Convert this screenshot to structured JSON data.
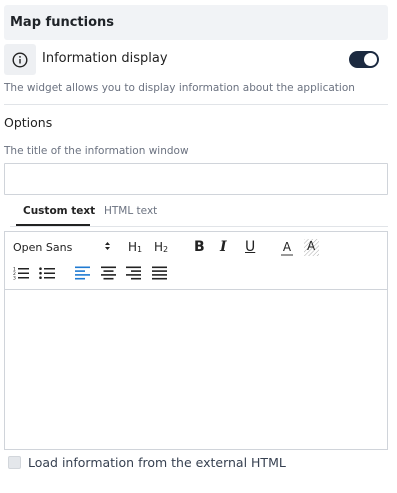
{
  "section": {
    "title": "Map functions"
  },
  "feature": {
    "label": "Information display",
    "enabled": true,
    "description": "The widget allows you to display information about the application",
    "icon": "info-circle-icon"
  },
  "options": {
    "label": "Options",
    "title_field": {
      "label": "The title of the information window",
      "value": "",
      "placeholder": ""
    }
  },
  "tabs": [
    {
      "label": "Custom text",
      "active": true
    },
    {
      "label": "HTML text",
      "active": false
    }
  ],
  "editor": {
    "font": "Open Sans",
    "heading1": "H",
    "heading1_sub": "1",
    "heading2": "H",
    "heading2_sub": "2",
    "bold": "B",
    "italic": "I",
    "underline": "U",
    "font_color_glyph": "A",
    "background_color_glyph": "A",
    "content": "",
    "accent_color": "#1f7ad1"
  },
  "external": {
    "label": "Load information from the external HTML",
    "checked": false
  }
}
